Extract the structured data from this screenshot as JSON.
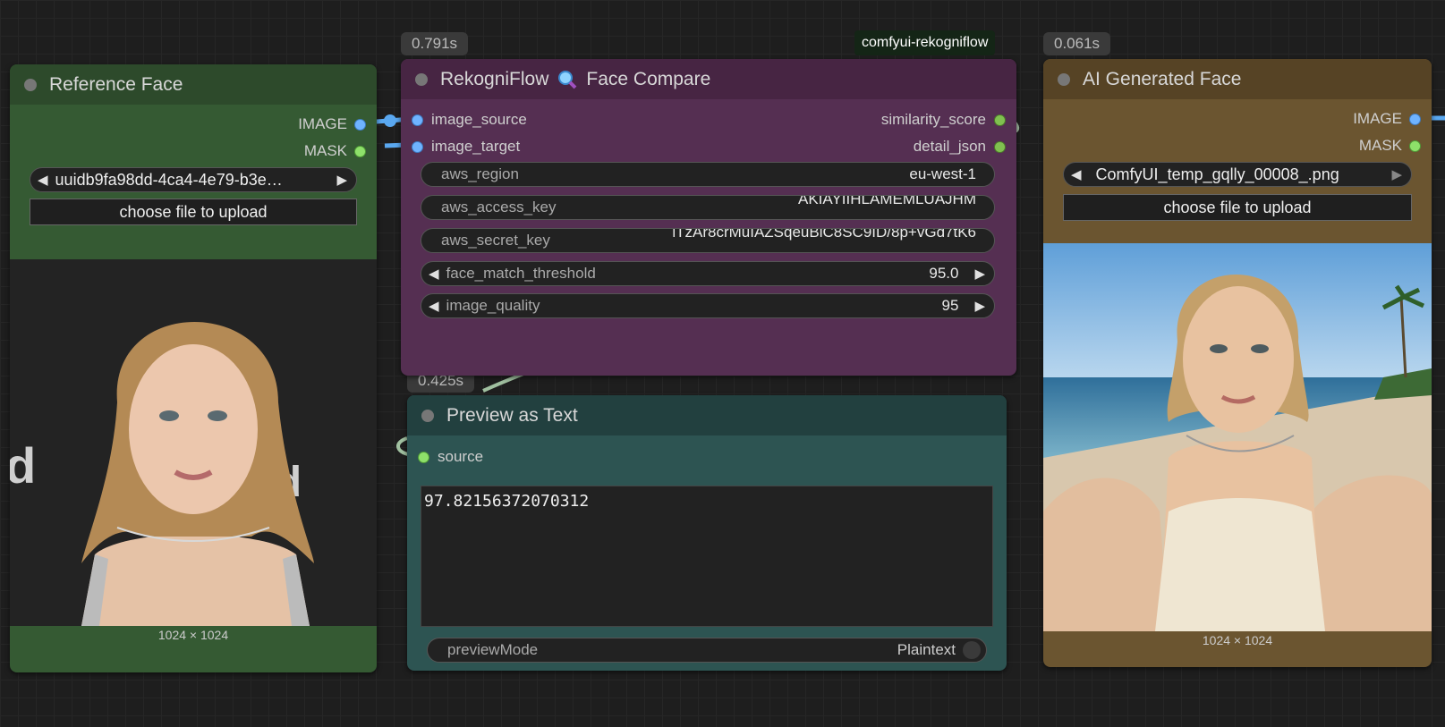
{
  "badges": {
    "compare_time": "0.791s",
    "ai_time": "0.061s",
    "preview_time": "0.425s",
    "package": "comfyui-rekogniflow"
  },
  "reference_node": {
    "title": "Reference Face",
    "outputs": [
      "IMAGE",
      "MASK"
    ],
    "file": "uuidb9fa98dd-4ca4-4e79-b3e…",
    "upload_label": "choose file to upload",
    "dims": "1024 × 1024"
  },
  "compare_node": {
    "title_prefix": "RekogniFlow",
    "title_icon": "magnifier-icon",
    "title_suffix": "Face Compare",
    "inputs": [
      "image_source",
      "image_target"
    ],
    "outputs": [
      "similarity_score",
      "detail_json"
    ],
    "widgets": {
      "aws_region": {
        "label": "aws_region",
        "value": "eu-west-1"
      },
      "aws_access_key": {
        "label": "aws_access_key",
        "value": "AKIAYIIHLAMEMLUAJHM"
      },
      "aws_secret_key": {
        "label": "aws_secret_key",
        "value": "iTzAr8crMuIAZSqeuBiC8SC9ID/8p+vGd7tK6"
      },
      "face_match_threshold": {
        "label": "face_match_threshold",
        "value": "95.0"
      },
      "image_quality": {
        "label": "image_quality",
        "value": "95"
      }
    }
  },
  "preview_node": {
    "title": "Preview as Text",
    "input": "source",
    "text": "97.82156372070312",
    "mode_label": "previewMode",
    "mode_value": "Plaintext"
  },
  "ai_node": {
    "title": "AI Generated Face",
    "outputs": [
      "IMAGE",
      "MASK"
    ],
    "file": "ComfyUI_temp_gqlly_00008_.png",
    "upload_label": "choose file to upload",
    "dims": "1024 × 1024"
  },
  "colors": {
    "reference_header": "#2d4a2b",
    "reference_body": "#355a33",
    "compare_header": "#472543",
    "compare_body": "#552f52",
    "preview_header": "#22403f",
    "preview_body": "#2d5452",
    "ai_header": "#564325",
    "ai_body": "#6b5530",
    "link_blue": "#5aa8f0",
    "link_green": "#a0c0a0"
  }
}
